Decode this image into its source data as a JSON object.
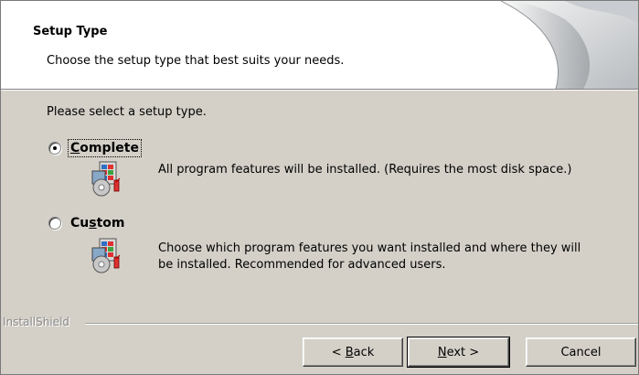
{
  "header": {
    "title": "Setup Type",
    "subtitle": "Choose the setup type that best suits your needs."
  },
  "prompt": "Please select a setup type.",
  "options": [
    {
      "label_pre": "",
      "label_mnemonic": "C",
      "label_post": "omplete",
      "selected": true,
      "description": "All program features will be installed. (Requires the most disk space.)",
      "icon": "package-install-icon"
    },
    {
      "label_pre": "Cu",
      "label_mnemonic": "s",
      "label_post": "tom",
      "selected": false,
      "description": "Choose which program features you want installed and where they will be installed. Recommended for advanced users.",
      "icon": "package-install-icon"
    }
  ],
  "branding": "InstallShield",
  "buttons": {
    "back_pre": "< ",
    "back_mnemonic": "B",
    "back_post": "ack",
    "next_mnemonic": "N",
    "next_post": "ext >",
    "cancel": "Cancel"
  },
  "colors": {
    "dialog_bg": "#d4d0c8",
    "header_bg": "#ffffff"
  }
}
